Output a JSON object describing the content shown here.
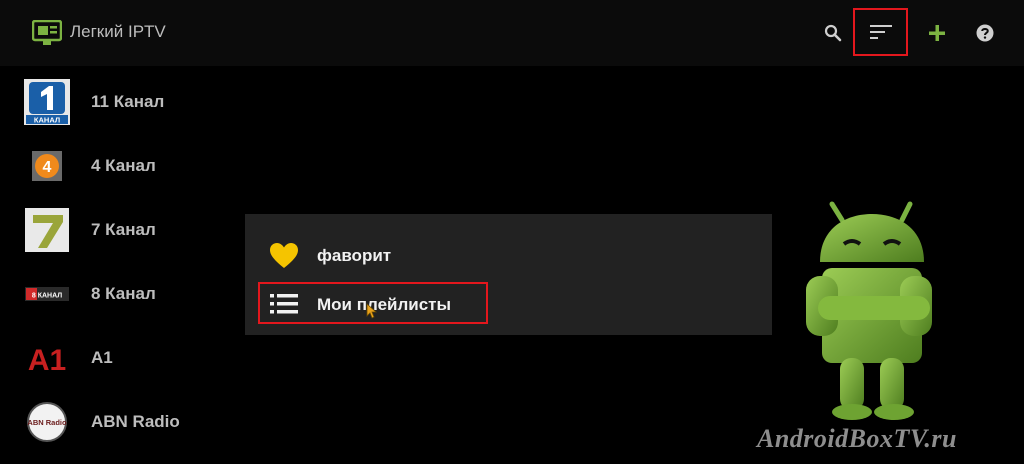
{
  "app": {
    "title": "Легкий IPTV"
  },
  "channels": [
    {
      "name": "11 Канал",
      "logo_text": "КАНАЛ"
    },
    {
      "name": "4 Канал",
      "logo_text": "4"
    },
    {
      "name": "7 Канал",
      "logo_text": "7"
    },
    {
      "name": "8 Канал",
      "logo_text": "8 КАНАЛ"
    },
    {
      "name": "A1",
      "logo_text": "A1"
    },
    {
      "name": "ABN Radio",
      "logo_text": "ABN Radio"
    }
  ],
  "menu": {
    "items": [
      {
        "label": "фаворит",
        "icon": "heart-icon"
      },
      {
        "label": "Мои плейлисты",
        "icon": "list-icon"
      }
    ]
  },
  "colors": {
    "accent_green": "#7cb342",
    "highlight_red": "#e3171d",
    "heart_yellow": "#f5c400"
  },
  "watermark": "AndroidBoxTV.ru"
}
